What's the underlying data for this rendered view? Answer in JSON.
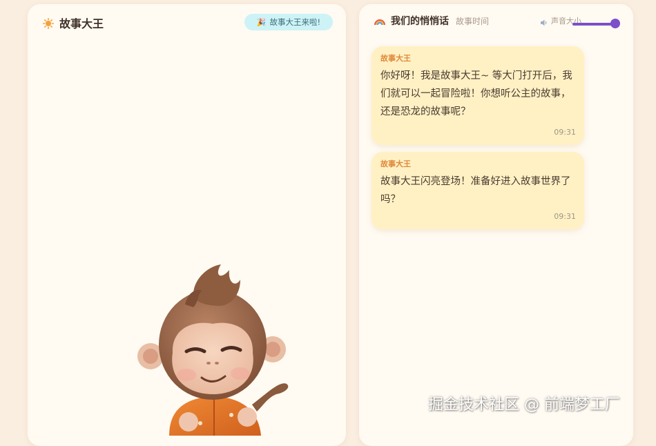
{
  "left_panel": {
    "title": "故事大王",
    "title_icon": "sun-icon",
    "badge": {
      "icon": "party-popper-icon",
      "label": "故事大王来啦!"
    },
    "avatar": "monkey-avatar"
  },
  "right_panel": {
    "title": "我们的悄悄话",
    "title_icon": "rainbow-icon",
    "subtitle": "故事时间",
    "volume": {
      "icon": "speaker-icon",
      "label": "声音大小",
      "level_fraction": 0.95
    },
    "messages": [
      {
        "sender": "故事大王",
        "text": "你好呀！我是故事大王~ 等大门打开后，我们就可以一起冒险啦！你想听公主的故事，还是恐龙的故事呢？",
        "time": "09:31"
      },
      {
        "sender": "故事大王",
        "text": "故事大王闪亮登场！准备好进入故事世界了吗？",
        "time": "09:31"
      }
    ]
  },
  "watermark": "掘金技术社区 @ 前端梦工厂",
  "colors": {
    "background": "#faeee0",
    "panel": "#fffaf2",
    "bubble": "#fff1c4",
    "accent": "#7d4fc8",
    "badge": "#cdf3f7",
    "sender": "#e0883a"
  }
}
